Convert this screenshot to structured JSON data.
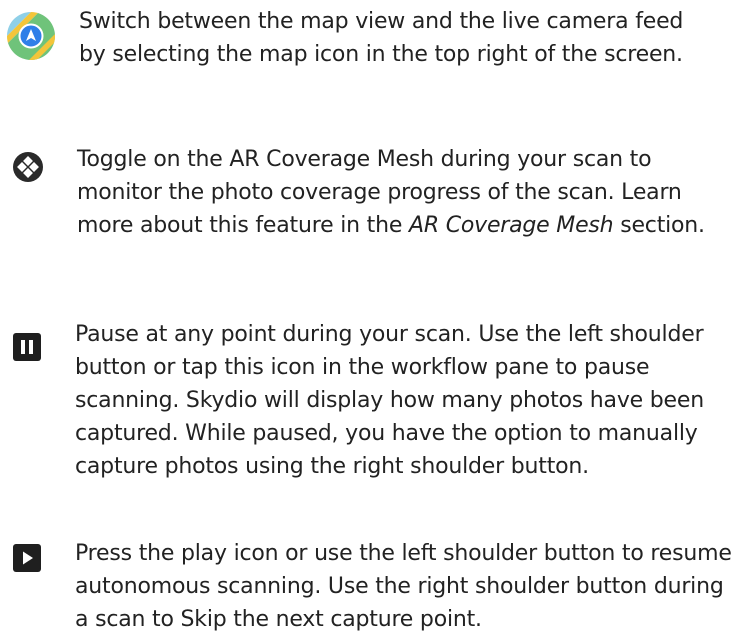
{
  "items": [
    {
      "icon": "map-icon",
      "lines": [
        "Switch between the map view and the live camera feed",
        "by selecting the map icon in the top right of the screen."
      ]
    },
    {
      "icon": "ar-coverage-mesh-icon",
      "lines": [
        "Toggle on the AR Coverage Mesh during your scan to",
        "monitor the photo coverage progress of the scan. Learn",
        "more about this feature in the "
      ],
      "emphasis": "AR Coverage Mesh",
      "suffix": " section."
    },
    {
      "icon": "pause-icon",
      "lines": [
        "Pause at any point during your scan. Use the left shoulder",
        "button or tap this icon in the workflow pane to pause",
        "scanning. Skydio will display how many photos have been",
        "captured. While paused, you have the option to manually",
        "capture photos using the right shoulder button."
      ]
    },
    {
      "icon": "play-icon",
      "lines": [
        "Press the play icon or use the left shoulder button to resume",
        "autonomous scanning. Use the right shoulder button during",
        "a scan to Skip the next capture point."
      ]
    }
  ],
  "colors": {
    "text": "#222222",
    "icon_dark": "#1f1f1f",
    "map_blue": "#2f7fe8",
    "map_green": "#6fc37a",
    "map_yellow": "#f3c53a"
  }
}
